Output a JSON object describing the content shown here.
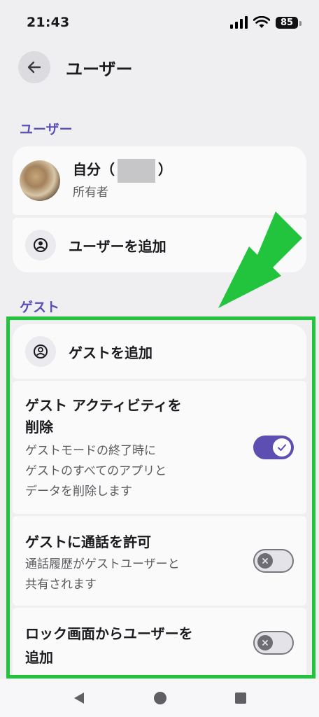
{
  "status_bar": {
    "time": "21:43",
    "battery": "85"
  },
  "header": {
    "title": "ユーザー"
  },
  "users_section": {
    "label": "ユーザー",
    "me": {
      "name_prefix": "自分（",
      "name_suffix": "）",
      "role": "所有者"
    },
    "add_user_label": "ユーザーを追加"
  },
  "guest_section": {
    "label": "ゲスト",
    "add_guest_label": "ゲストを追加",
    "delete_activity": {
      "title_line1": "ゲスト アクティビティを",
      "title_line2": "削除",
      "desc_line1": "ゲストモードの終了時に",
      "desc_line2": "ゲストのすべてのアプリと",
      "desc_line3": "データを削除します",
      "enabled": true
    },
    "allow_calls": {
      "title": "ゲストに通話を許可",
      "desc_line1": "通話履歴がゲストユーザーと",
      "desc_line2": "共有されます",
      "enabled": false
    },
    "lock_screen_add": {
      "title_line1": "ロック画面からユーザーを",
      "title_line2": "追加",
      "enabled": false
    }
  },
  "colors": {
    "accent": "#5c4fb1",
    "highlight": "#22c43d",
    "background": "#efeff1"
  },
  "icons": [
    "back-arrow-icon",
    "account-circle-icon",
    "check-icon",
    "close-icon",
    "nav-back-icon",
    "nav-home-icon",
    "nav-recents-icon"
  ]
}
